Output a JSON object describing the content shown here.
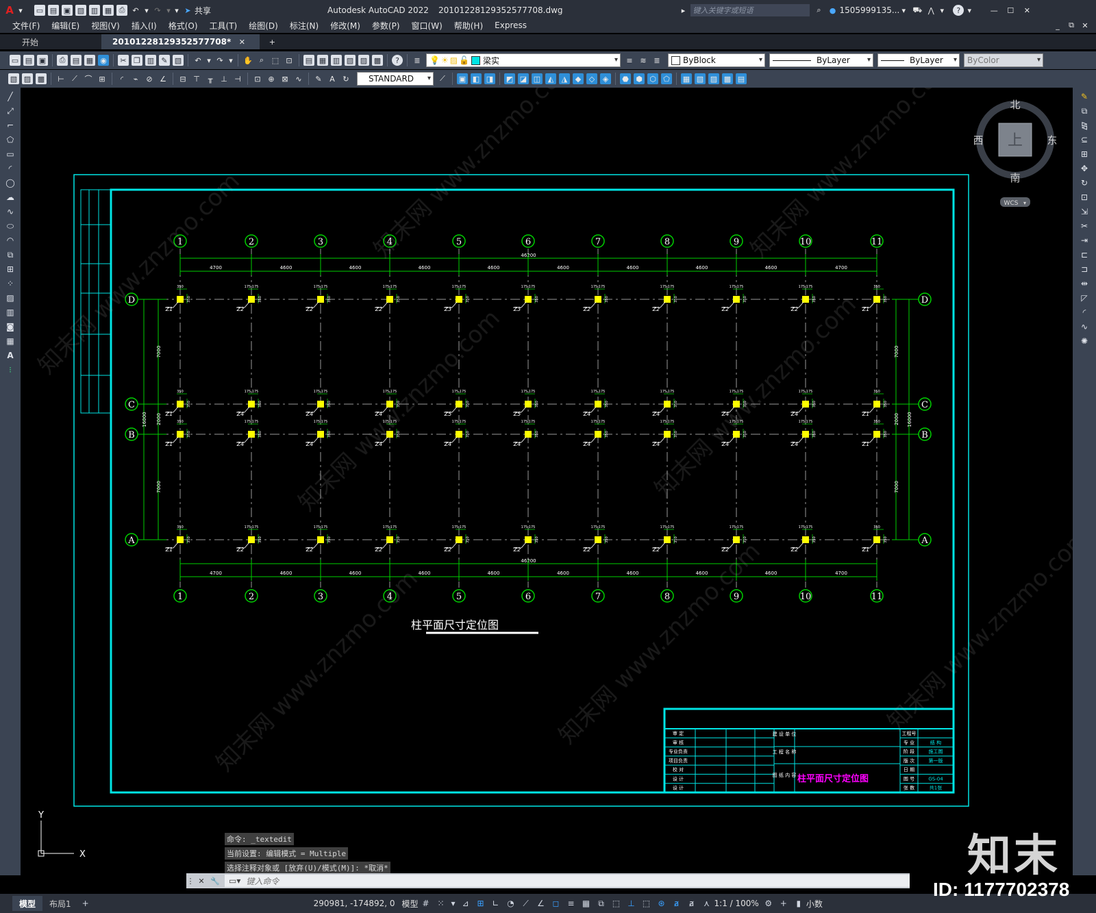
{
  "app": {
    "title": "Autodesk AutoCAD 2022",
    "filename": "20101228129352577708.dwg",
    "share_label": "共享",
    "search_placeholder": "键入关键字或短语",
    "username": "1505999135...",
    "app_icon": "autocad-logo-icon"
  },
  "menu": [
    "文件(F)",
    "编辑(E)",
    "视图(V)",
    "插入(I)",
    "格式(O)",
    "工具(T)",
    "绘图(D)",
    "标注(N)",
    "修改(M)",
    "参数(P)",
    "窗口(W)",
    "帮助(H)",
    "Express"
  ],
  "tabs": {
    "start": "开始",
    "file": "20101228129352577708*"
  },
  "toolbar": {
    "layer": "梁实",
    "color": "ByBlock",
    "linetype": "ByLayer",
    "lineweight": "ByLayer",
    "plotstyle": "ByColor",
    "textstyle": "STANDARD"
  },
  "viewcube": {
    "north": "北",
    "south": "南",
    "east": "东",
    "west": "西",
    "top": "上",
    "wcs": "WCS"
  },
  "drawing": {
    "title": "柱平面尺寸定位图",
    "col_labels": [
      "1",
      "2",
      "3",
      "4",
      "5",
      "6",
      "7",
      "8",
      "9",
      "10",
      "11"
    ],
    "row_labels": [
      "D",
      "C",
      "B",
      "A"
    ],
    "bay_dims": [
      "4700",
      "4600",
      "4600",
      "4600",
      "4600",
      "4600",
      "4600",
      "4600",
      "4600",
      "4700"
    ],
    "total_length": "46200",
    "span_dims": [
      "7000",
      "2000",
      "7000"
    ],
    "total_width": "16000",
    "col_tags": {
      "D": [
        "Z1",
        "Z2",
        "Z2",
        "Z2",
        "Z3",
        "Z3",
        "Z2",
        "Z2",
        "Z2",
        "Z2",
        "Z1"
      ],
      "C": [
        "Z1",
        "Z4",
        "Z4",
        "Z4",
        "Z5",
        "Z5",
        "Z4",
        "Z4",
        "Z4",
        "Z4",
        "Z1"
      ],
      "B": [
        "Z1",
        "Z4",
        "Z4",
        "Z4",
        "Z4",
        "Z4",
        "Z4",
        "Z4",
        "Z4",
        "Z4",
        "Z1"
      ],
      "A": [
        "Z1",
        "Z2",
        "Z2",
        "Z2",
        "Z2",
        "Z2",
        "Z2",
        "Z2",
        "Z2",
        "Z2",
        "Z1"
      ]
    },
    "col_size_top": "175 175",
    "col_size_side": "350"
  },
  "titleblock": {
    "left": [
      "审 定",
      "审 核",
      "专业负责",
      "项目负责",
      "校 对",
      "设 计",
      "设 计"
    ],
    "mid": [
      "建 设 单 位",
      "工 程 名 称",
      "图 纸 内 容"
    ],
    "right": [
      "工程号",
      "专 业",
      "阶 段",
      "版 次",
      "日 期",
      "图 号",
      "张 数"
    ],
    "right_values": [
      "",
      "结 构",
      "施工图",
      "第一版",
      "",
      "GS-04",
      "共1张"
    ],
    "drawing_name": "柱平面尺寸定位图"
  },
  "command": {
    "history": [
      "命令: _textedit",
      "当前设置: 编辑模式 = Multiple",
      "选择注释对象或 [放弃(U)/模式(M)]: *取消*"
    ],
    "placeholder": "键入命令"
  },
  "status": {
    "tabs": [
      "模型",
      "布局1"
    ],
    "coords": "290981, -174892, 0",
    "mode": "模型",
    "scale": "1:1 / 100%",
    "units": "小数"
  },
  "watermark": {
    "logo": "知末",
    "id": "ID: 1177702378",
    "text": "知末网 www.znzmo.com"
  },
  "colors": {
    "frame": "#00e5e5",
    "grid": "#00d000",
    "column": "#ffff00",
    "axis": "#ffffff",
    "highlight": "#ff00ff"
  }
}
